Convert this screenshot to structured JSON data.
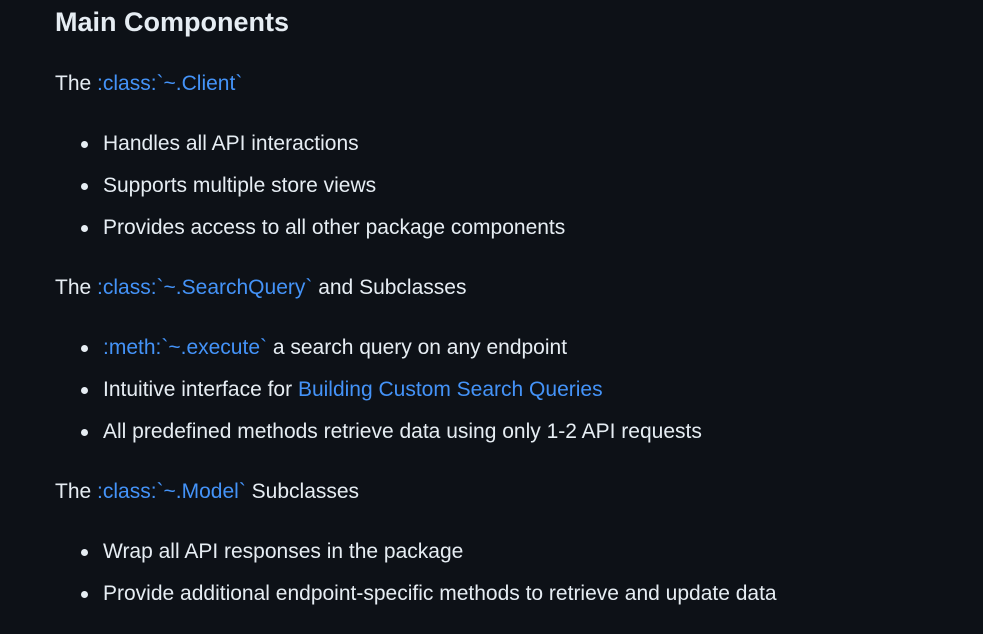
{
  "heading": "Main Components",
  "sections": [
    {
      "intro": {
        "prefix": "The ",
        "link": ":class:`~.Client`",
        "suffix": ""
      },
      "items": [
        {
          "text": "Handles all API interactions"
        },
        {
          "text": "Supports multiple store views"
        },
        {
          "text": "Provides access to all other package components"
        }
      ]
    },
    {
      "intro": {
        "prefix": "The ",
        "link": ":class:`~.SearchQuery`",
        "suffix": " and Subclasses"
      },
      "items": [
        {
          "link": ":meth:`~.execute`",
          "text": " a search query on any endpoint"
        },
        {
          "text": "Intuitive interface for ",
          "link": "Building Custom Search Queries"
        },
        {
          "text": "All predefined methods retrieve data using only 1-2 API requests"
        }
      ]
    },
    {
      "intro": {
        "prefix": "The ",
        "link": ":class:`~.Model`",
        "suffix": " Subclasses"
      },
      "items": [
        {
          "text": "Wrap all API responses in the package"
        },
        {
          "text": "Provide additional endpoint-specific methods to retrieve and update data"
        }
      ]
    }
  ],
  "colors": {
    "background": "#0d1117",
    "text": "#e6edf3",
    "link": "#4493f8"
  }
}
